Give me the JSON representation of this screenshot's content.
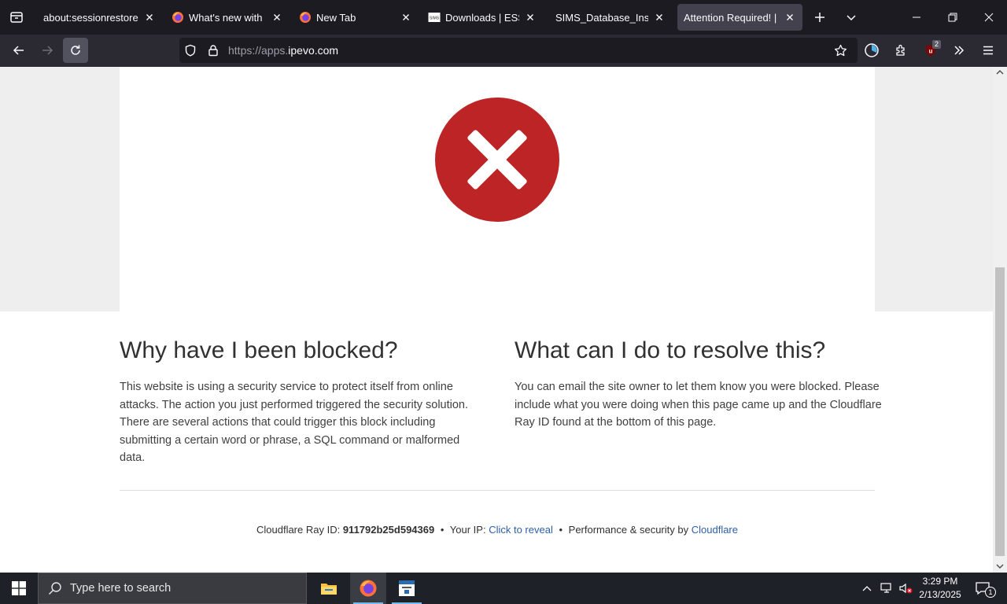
{
  "browser": {
    "tabs": [
      {
        "title": "about:sessionrestore",
        "icon": "none"
      },
      {
        "title": "What's new with Firefox",
        "icon": "firefox-icon"
      },
      {
        "title": "New Tab",
        "icon": "firefox-icon"
      },
      {
        "title": "Downloads | ESS SIMS",
        "icon": "sims-icon"
      },
      {
        "title": "SIMS_Database_Install.pdf",
        "icon": "none"
      },
      {
        "title": "Attention Required! | Cloudflare",
        "icon": "none",
        "active": true
      }
    ],
    "url_prefix": "https://apps.",
    "url_domain": "ipevo.com",
    "extension_badge": "2"
  },
  "page": {
    "left_heading": "Why have I been blocked?",
    "left_text": "This website is using a security service to protect itself from online attacks. The action you just performed triggered the security solution. There are several actions that could trigger this block including submitting a certain word or phrase, a SQL command or malformed data.",
    "right_heading": "What can I do to resolve this?",
    "right_text": "You can email the site owner to let them know you were blocked. Please include what you were doing when this page came up and the Cloudflare Ray ID found at the bottom of this page.",
    "footer": {
      "ray_label": "Cloudflare Ray ID:",
      "ray_id": "911792b25d594369",
      "sep": "•",
      "ip_label": "Your IP:",
      "ip_link": "Click to reveal",
      "perf_label": "Performance & security by",
      "perf_link": "Cloudflare"
    },
    "colors": {
      "error_red": "#bd2426",
      "link": "#2c5ea6"
    }
  },
  "taskbar": {
    "search_placeholder": "Type here to search",
    "time": "3:29 PM",
    "date": "2/13/2025",
    "notification_count": "1"
  }
}
